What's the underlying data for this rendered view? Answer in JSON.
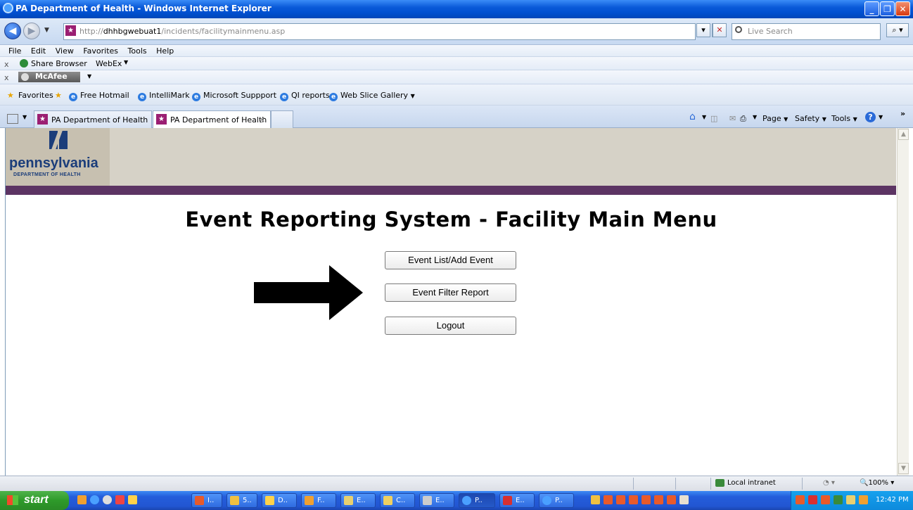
{
  "window": {
    "title": "PA Department of Health - Windows Internet Explorer"
  },
  "address": {
    "url_prefix": "http://",
    "url_host": "dhhbgwebuat1",
    "url_path": "/incidents/facilitymainmenu.asp",
    "search_placeholder": "Live Search"
  },
  "menu": [
    "File",
    "Edit",
    "View",
    "Favorites",
    "Tools",
    "Help"
  ],
  "toolbars": {
    "share_browser": "Share Browser",
    "webex": "WebEx",
    "mcafee": "McAfee"
  },
  "favorites": {
    "label": "Favorites",
    "items": [
      "Free Hotmail",
      "IntelliMark",
      "Microsoft Suppport",
      "QI reports",
      "Web Slice Gallery"
    ]
  },
  "tabs": [
    {
      "label": "PA Department of Health",
      "active": false
    },
    {
      "label": "PA Department of Health",
      "active": true
    }
  ],
  "command_bar": {
    "page": "Page",
    "safety": "Safety",
    "tools": "Tools"
  },
  "page": {
    "logo_word": "pennsylvania",
    "logo_dept": "DEPARTMENT OF HEALTH",
    "heading": "Event Reporting System - Facility Main Menu",
    "buttons": [
      "Event List/Add Event",
      "Event Filter Report",
      "Logout"
    ]
  },
  "status": {
    "zone": "Local intranet",
    "zoom": "100%"
  },
  "taskbar": {
    "start": "start",
    "items": [
      "I..",
      "5..",
      "D..",
      "F..",
      "E..",
      "C..",
      "E..",
      "P..",
      "E..",
      "P.."
    ],
    "clock": "12:42 PM"
  },
  "colors": {
    "banner": "#d6d2c7",
    "purple_bar": "#5c3463",
    "logo_blue": "#1b3d7a"
  }
}
